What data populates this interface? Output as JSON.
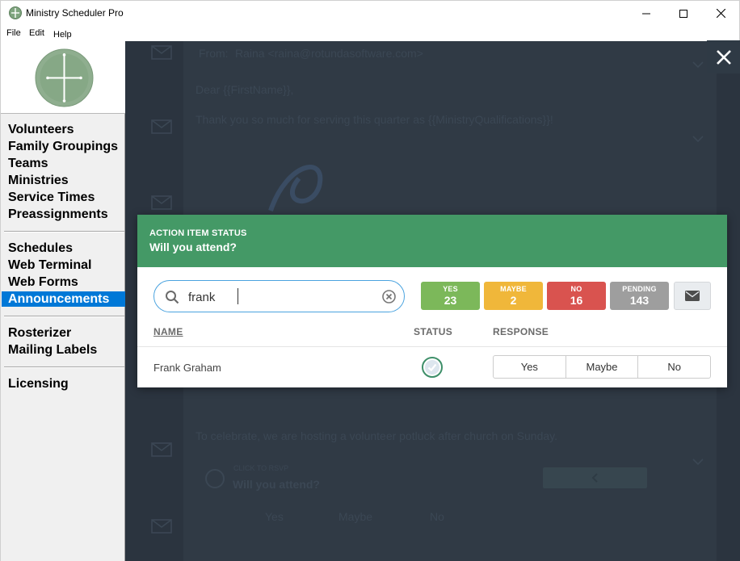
{
  "window": {
    "title": "Ministry Scheduler Pro"
  },
  "menu": [
    "File",
    "Edit",
    "Help"
  ],
  "sidebar": {
    "groups": [
      [
        "Volunteers",
        "Family Groupings",
        "Teams",
        "Ministries",
        "Service Times",
        "Preassignments"
      ],
      [
        "Schedules",
        "Web Terminal",
        "Web Forms",
        "Announcements"
      ],
      [
        "Rosterizer",
        "Mailing Labels"
      ],
      [
        "Licensing"
      ]
    ],
    "active": "Announcements"
  },
  "background": {
    "from_label": "From:",
    "from_value": "Raina <raina@rotundasoftware.com>",
    "greeting": "Dear {{FirstName}},",
    "thanks": "Thank you so much for serving this quarter as {{MinistryQualifications}}!",
    "celebrate": "To celebrate, we are hosting a volunteer potluck after church on Sunday.",
    "rsvp_kicker": "CLICK TO RSVP",
    "rsvp_title": "Will you attend?",
    "rsvp_options": [
      "Yes",
      "Maybe",
      "No"
    ]
  },
  "dialog": {
    "kicker": "ACTION ITEM STATUS",
    "title": "Will you attend?",
    "search": {
      "value": "frank"
    },
    "counts": [
      {
        "label": "YES",
        "value": "23",
        "color": "#7cb85a"
      },
      {
        "label": "MAYBE",
        "value": "2",
        "color": "#f0b73a"
      },
      {
        "label": "NO",
        "value": "16",
        "color": "#d9534f"
      },
      {
        "label": "PENDING",
        "value": "143",
        "color": "#9e9e9e"
      }
    ],
    "columns": {
      "name": "NAME",
      "status": "STATUS",
      "response": "RESPONSE"
    },
    "rows": [
      {
        "name": "Frank Graham",
        "status": "check-icon",
        "responses": [
          "Yes",
          "Maybe",
          "No"
        ]
      }
    ]
  },
  "colors": {
    "header_green": "#449966",
    "active_nav": "#0078d7",
    "overlay": "#2b343f"
  }
}
